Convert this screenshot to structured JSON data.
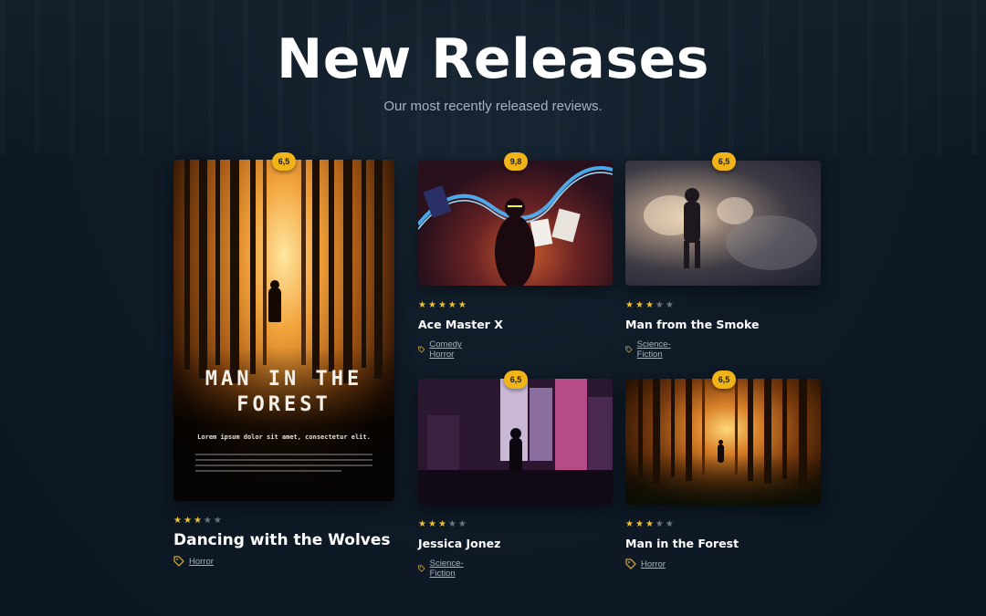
{
  "header": {
    "title": "New Releases",
    "subtitle": "Our most recently released reviews."
  },
  "colors": {
    "background": "#0f1b27",
    "badge": "#f0b418",
    "star_on": "#f3c02a",
    "star_off": "#6d7782"
  },
  "featured": {
    "rating": "6,5",
    "stars": 3,
    "title": "Dancing with the Wolves",
    "genre": "Horror",
    "poster": {
      "title_line1": "MAN IN THE",
      "title_line2": "FOREST",
      "tagline": "Lorem ipsum dolor sit amet, consectetur elit."
    }
  },
  "cards": [
    {
      "rating": "9,8",
      "stars": 5,
      "title": "Ace Master X",
      "genre": "Comedy Horror"
    },
    {
      "rating": "6,5",
      "stars": 3,
      "title": "Man from the Smoke",
      "genre": "Science-Fiction"
    },
    {
      "rating": "6,5",
      "stars": 3,
      "title": "Jessica Jonez",
      "genre": "Science-Fiction"
    },
    {
      "rating": "6,5",
      "stars": 3,
      "title": "Man in the Forest",
      "genre": "Horror"
    }
  ],
  "icons": {
    "star": "star-icon",
    "genre": "tag-icon"
  }
}
